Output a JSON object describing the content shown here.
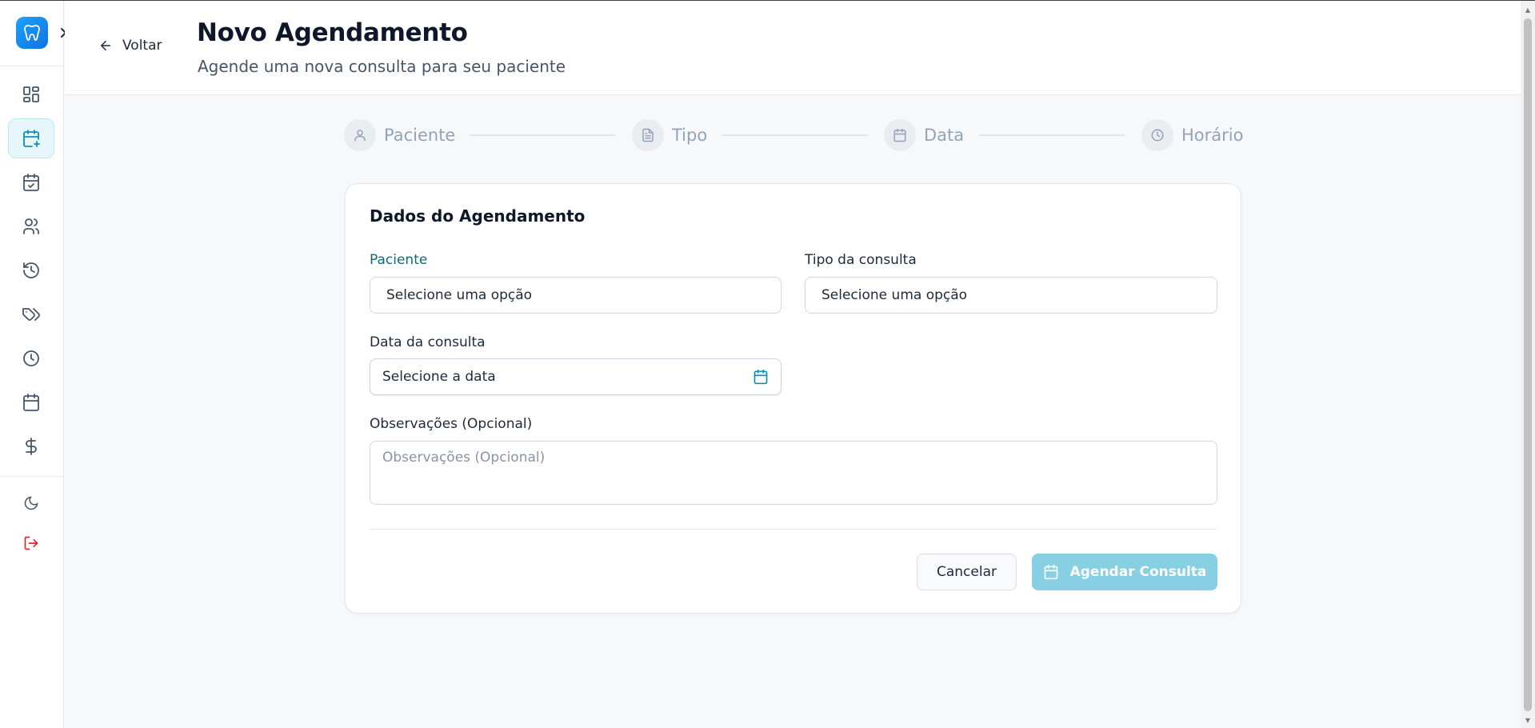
{
  "colors": {
    "brand": "#1ba2ff",
    "accent": "#0e8fb0",
    "primary_button": "#87cfe3",
    "logout": "#dc2626"
  },
  "sidebar": {
    "logo_icon": "tooth-icon",
    "items": [
      {
        "icon": "dashboard-icon",
        "active": false
      },
      {
        "icon": "calendar-plus-icon",
        "active": true
      },
      {
        "icon": "calendar-check-icon",
        "active": false
      },
      {
        "icon": "users-icon",
        "active": false
      },
      {
        "icon": "history-icon",
        "active": false
      },
      {
        "icon": "tags-icon",
        "active": false
      },
      {
        "icon": "clock-icon",
        "active": false
      },
      {
        "icon": "calendar-icon",
        "active": false
      },
      {
        "icon": "dollar-icon",
        "active": false
      }
    ],
    "footer": [
      {
        "icon": "moon-icon"
      },
      {
        "icon": "logout-icon"
      }
    ]
  },
  "header": {
    "back_label": "Voltar",
    "title": "Novo Agendamento",
    "subtitle": "Agende uma nova consulta para seu paciente"
  },
  "stepper": {
    "steps": [
      {
        "label": "Paciente",
        "icon": "user-icon"
      },
      {
        "label": "Tipo",
        "icon": "document-icon"
      },
      {
        "label": "Data",
        "icon": "calendar-icon"
      },
      {
        "label": "Horário",
        "icon": "clock-icon"
      }
    ]
  },
  "form": {
    "title": "Dados do Agendamento",
    "patient": {
      "label": "Paciente",
      "value": "Selecione uma opção"
    },
    "type": {
      "label": "Tipo da consulta",
      "value": "Selecione uma opção"
    },
    "date": {
      "label": "Data da consulta",
      "value": "Selecione a data"
    },
    "notes": {
      "label": "Observações (Opcional)",
      "placeholder": "Observações (Opcional)"
    },
    "cancel_label": "Cancelar",
    "submit_label": "Agendar Consulta"
  }
}
